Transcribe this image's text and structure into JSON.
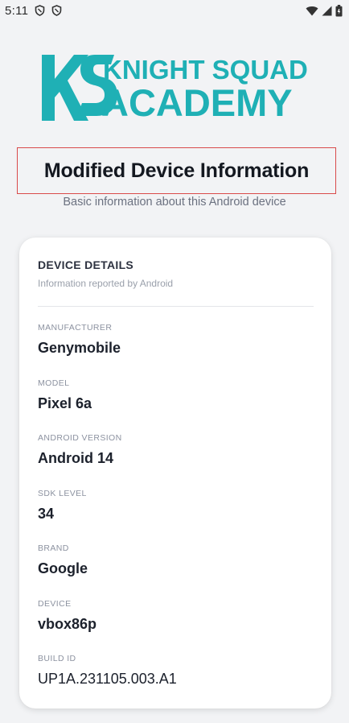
{
  "status_bar": {
    "time": "5:11",
    "icons": [
      "shield-icon",
      "shield-icon",
      "wifi-icon",
      "signal-icon",
      "battery-icon"
    ]
  },
  "logo": {
    "monogram": "KS",
    "line1": "KNIGHT SQUAD",
    "line2": "ACADEMY",
    "color": "#1fb0b5"
  },
  "page": {
    "title": "Modified Device Information",
    "subtitle": "Basic information about this Android device"
  },
  "card": {
    "title": "DEVICE DETAILS",
    "subtitle": "Information reported by Android",
    "fields": [
      {
        "label": "MANUFACTURER",
        "value": "Genymobile"
      },
      {
        "label": "MODEL",
        "value": "Pixel 6a"
      },
      {
        "label": "ANDROID VERSION",
        "value": "Android 14"
      },
      {
        "label": "SDK LEVEL",
        "value": "34"
      },
      {
        "label": "BRAND",
        "value": "Google"
      },
      {
        "label": "DEVICE",
        "value": "vbox86p"
      },
      {
        "label": "BUILD ID",
        "value": "UP1A.231105.003.A1"
      }
    ]
  },
  "colors": {
    "accent": "#1fb0b5",
    "highlight_border": "#d94a4a",
    "background": "#f2f3f5"
  }
}
